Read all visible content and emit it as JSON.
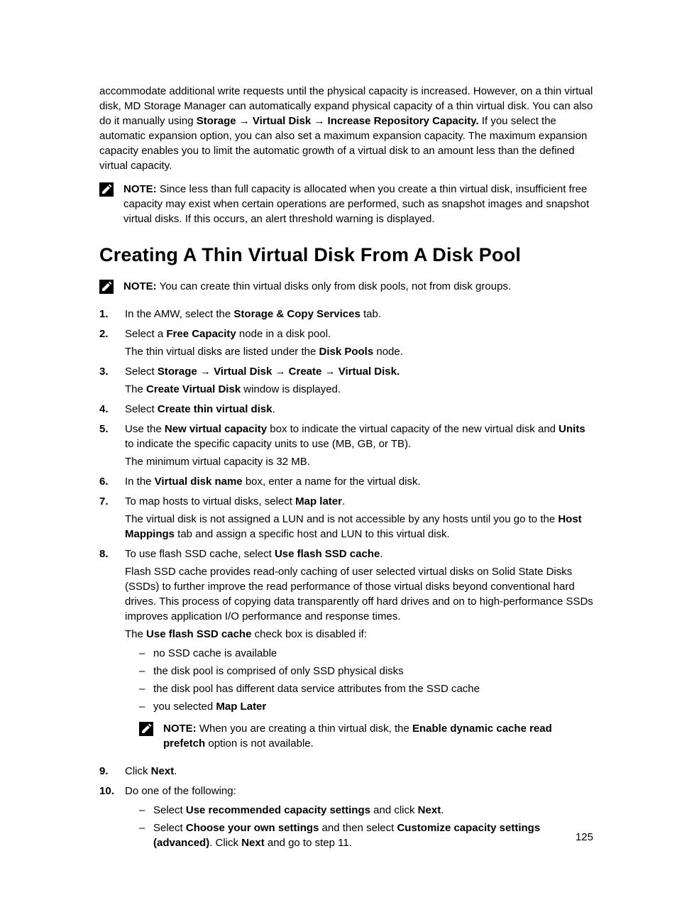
{
  "intro": {
    "p1_a": "accommodate additional write requests until the physical capacity is increased. However, on a thin virtual disk, MD Storage Manager can automatically expand physical capacity of a thin virtual disk. You can also do it manually using ",
    "p1_bold": "Storage → Virtual Disk → Increase Repository Capacity.",
    "p1_b": " If you select the automatic expansion option, you can also set a maximum expansion capacity. The maximum expansion capacity enables you to limit the automatic growth of a virtual disk to an amount less than the defined virtual capacity."
  },
  "note1": {
    "label": "NOTE:",
    "text": " Since less than full capacity is allocated when you create a thin virtual disk, insufficient free capacity may exist when certain operations are performed, such as snapshot images and snapshot virtual disks. If this occurs, an alert threshold warning is displayed."
  },
  "heading": "Creating A Thin Virtual Disk From A Disk Pool",
  "note2": {
    "label": "NOTE:",
    "text": " You can create thin virtual disks only from disk pools, not from disk groups."
  },
  "steps": {
    "s1": {
      "a": "In the AMW, select the ",
      "b": "Storage & Copy Services",
      "c": " tab."
    },
    "s2": {
      "a": "Select a ",
      "b": "Free Capacity",
      "c": " node in a disk pool.",
      "sub_a": "The thin virtual disks are listed under the ",
      "sub_b": "Disk Pools",
      "sub_c": " node."
    },
    "s3": {
      "a": "Select ",
      "b": "Storage",
      "arr1": " → ",
      "c": "Virtual Disk",
      "arr2": " → ",
      "d": "Create",
      "arr3": " → ",
      "e": "Virtual Disk.",
      "sub_a": "The ",
      "sub_b": "Create Virtual Disk",
      "sub_c": " window is displayed."
    },
    "s4": {
      "a": "Select ",
      "b": "Create thin virtual disk",
      "c": "."
    },
    "s5": {
      "a": "Use the ",
      "b": "New virtual capacity",
      "c": " box to indicate the virtual capacity of the new virtual disk and ",
      "d": "Units",
      "e": " to indicate the specific capacity units to use (MB, GB, or TB).",
      "sub": "The minimum virtual capacity is 32 MB."
    },
    "s6": {
      "a": "In the ",
      "b": "Virtual disk name",
      "c": " box, enter a name for the virtual disk."
    },
    "s7": {
      "a": "To map hosts to virtual disks, select ",
      "b": "Map later",
      "c": ".",
      "sub_a": "The virtual disk is not assigned a LUN and is not accessible by any hosts until you go to the ",
      "sub_b": "Host Mappings",
      "sub_c": " tab and assign a specific host and LUN to this virtual disk."
    },
    "s8": {
      "a": "To use flash SSD cache, select ",
      "b": "Use flash SSD cache",
      "c": ".",
      "p2": "Flash SSD cache provides read-only caching of user selected virtual disks on Solid State Disks (SSDs) to further improve the read performance of those virtual disks beyond conventional hard drives. This process of copying data transparently off hard drives and on to high-performance SSDs improves application I/O performance and response times.",
      "p3_a": "The ",
      "p3_b": "Use flash SSD cache",
      "p3_c": " check box is disabled if:",
      "d1": "no SSD cache is available",
      "d2": "the disk pool is comprised of only SSD physical disks",
      "d3": "the disk pool has different data service attributes from the SSD cache",
      "d4_a": "you selected ",
      "d4_b": "Map Later",
      "note_label": "NOTE:",
      "note_a": " When you are creating a thin virtual disk, the ",
      "note_b": "Enable dynamic cache read prefetch",
      "note_c": " option is not available."
    },
    "s9": {
      "a": "Click ",
      "b": "Next",
      "c": "."
    },
    "s10": {
      "a": "Do one of the following:",
      "d1_a": "Select ",
      "d1_b": "Use recommended capacity settings",
      "d1_c": " and click ",
      "d1_d": "Next",
      "d1_e": ".",
      "d2_a": "Select ",
      "d2_b": "Choose your own settings",
      "d2_c": " and then select ",
      "d2_d": "Customize capacity settings (advanced)",
      "d2_e": ". Click ",
      "d2_f": "Next",
      "d2_g": " and go to step 11."
    }
  },
  "page_number": "125"
}
